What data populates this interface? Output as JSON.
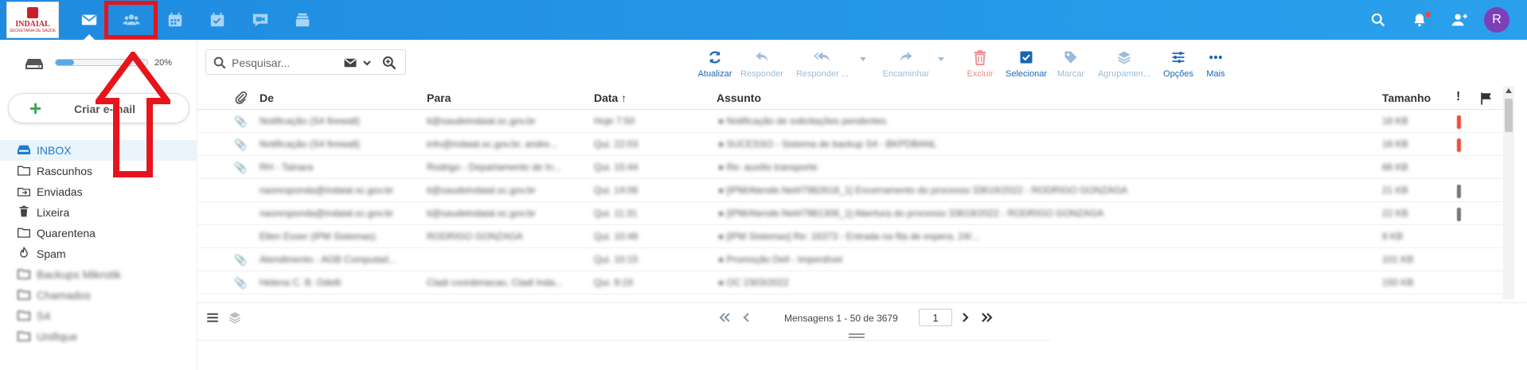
{
  "app": {
    "logo_line1": "INDAIAL",
    "logo_line2": "SECRETARIA DE SAÚDE",
    "avatar_initial": "R",
    "accent_color": "#1f8be0",
    "highlight_color": "#e8141b"
  },
  "topnav": [
    {
      "name": "mail",
      "icon": "envelope-icon",
      "active": true
    },
    {
      "name": "contacts",
      "icon": "contacts-icon",
      "highlighted": true
    },
    {
      "name": "calendar",
      "icon": "calendar-icon"
    },
    {
      "name": "tasks",
      "icon": "tasks-icon"
    },
    {
      "name": "chat",
      "icon": "video-chat-icon"
    },
    {
      "name": "files",
      "icon": "files-icon"
    }
  ],
  "topright": [
    "search-icon",
    "bell-icon",
    "add-user-icon",
    "avatar"
  ],
  "sidebar": {
    "storage_percent": "20%",
    "storage_fraction": 0.2,
    "compose_label": "Criar e-mail",
    "folders": [
      {
        "label": "INBOX",
        "icon": "inbox-icon",
        "active": true
      },
      {
        "label": "Rascunhos",
        "icon": "folder-icon"
      },
      {
        "label": "Enviadas",
        "icon": "send-icon"
      },
      {
        "label": "Lixeira",
        "icon": "trash-icon"
      },
      {
        "label": "Quarentena",
        "icon": "folder-icon"
      },
      {
        "label": "Spam",
        "icon": "fire-icon"
      },
      {
        "label": "Backups Mikrotik",
        "icon": "folder-icon"
      },
      {
        "label": "Chamados",
        "icon": "folder-icon"
      },
      {
        "label": "S4",
        "icon": "folder-icon"
      },
      {
        "label": "Unifique",
        "icon": "folder-icon"
      }
    ]
  },
  "search": {
    "placeholder": "Pesquisar..."
  },
  "toolbar": [
    {
      "label": "Atualizar",
      "icon": "refresh-icon",
      "state": "enabled"
    },
    {
      "label": "Responder",
      "icon": "reply-icon",
      "state": "disabled"
    },
    {
      "label": "Responder ...",
      "icon": "reply-all-icon",
      "state": "disabled"
    },
    {
      "label": "Encaminhar",
      "icon": "forward-icon",
      "state": "disabled"
    },
    {
      "label": "Excluir",
      "icon": "trash-icon",
      "state": "danger"
    },
    {
      "label": "Selecionar",
      "icon": "checkbox-icon",
      "state": "enabled"
    },
    {
      "label": "Marcar",
      "icon": "tag-icon",
      "state": "disabled"
    },
    {
      "label": "Agrupamen...",
      "icon": "layers-icon",
      "state": "disabled"
    },
    {
      "label": "Opções",
      "icon": "sliders-icon",
      "state": "enabled"
    },
    {
      "label": "Mais",
      "icon": "more-icon",
      "state": "enabled"
    }
  ],
  "table": {
    "headers": {
      "from": "De",
      "to": "Para",
      "date": "Data ↑",
      "subject": "Assunto",
      "size": "Tamanho",
      "priority": "!",
      "flag": "flag-icon"
    },
    "rows": [
      {
        "from": "Notificação (S4 firewall)",
        "to": "ti@saudeindaial.sc.gov.br",
        "date": "Hoje 7:50",
        "subject": "Notificação de solicitações pendentes",
        "size": "18 KB",
        "attach": true,
        "prio": "high"
      },
      {
        "from": "Notificação (S4 firewall)",
        "to": "info@indaial.sc.gov.br, andre...",
        "date": "Qui. 22:03",
        "subject": "SUCESSO - Sistema de backup S4 - BKPDBANL",
        "size": "18 KB",
        "attach": true,
        "prio": "high"
      },
      {
        "from": "RH - Tainara",
        "to": "Rodrigo - Departamento de In...",
        "date": "Qui. 15:44",
        "subject": "Re: auxílio transporte",
        "size": "66 KB",
        "attach": true,
        "prio": ""
      },
      {
        "from": "naoresponda@indaial.sc.gov.br",
        "to": "ti@saudeindaial.sc.gov.br",
        "date": "Qui. 14:06",
        "subject": "[IPM/Atende.Net#7982618_1] Encerramento do processo 33619/2022 - RODRIGO GONZAGA",
        "size": "21 KB",
        "attach": false,
        "prio": "normal"
      },
      {
        "from": "naoresponda@indaial.sc.gov.br",
        "to": "ti@saudeindaial.sc.gov.br",
        "date": "Qui. 11:31",
        "subject": "[IPM/Atende.Net#7981306_1] Abertura do processo 33619/2022 - RODRIGO GONZAGA",
        "size": "22 KB",
        "attach": false,
        "prio": "normal"
      },
      {
        "from": "Ellen Esser (IPM Sistemas)",
        "to": "RODRIGO GONZAGA",
        "date": "Qui. 10:48",
        "subject": "[IPM Sistemas] Re: 16373 - Entrada na fila de espera. 24/...",
        "size": "9 KB",
        "attach": false,
        "prio": ""
      },
      {
        "from": "Atendimento - AGB Computad...",
        "to": "",
        "date": "Qui. 10:15",
        "subject": "Promoção Dell - Imperdível",
        "size": "101 KB",
        "attach": true,
        "prio": ""
      },
      {
        "from": "Helena C. B. Odelli",
        "to": "Cladi coordenacao, Cladi Inda...",
        "date": "Qui. 9:19",
        "subject": "OC 2303/2022",
        "size": "150 KB",
        "attach": true,
        "prio": ""
      }
    ]
  },
  "pager": {
    "label": "Mensagens 1 - 50 de 3679",
    "page": "1"
  }
}
